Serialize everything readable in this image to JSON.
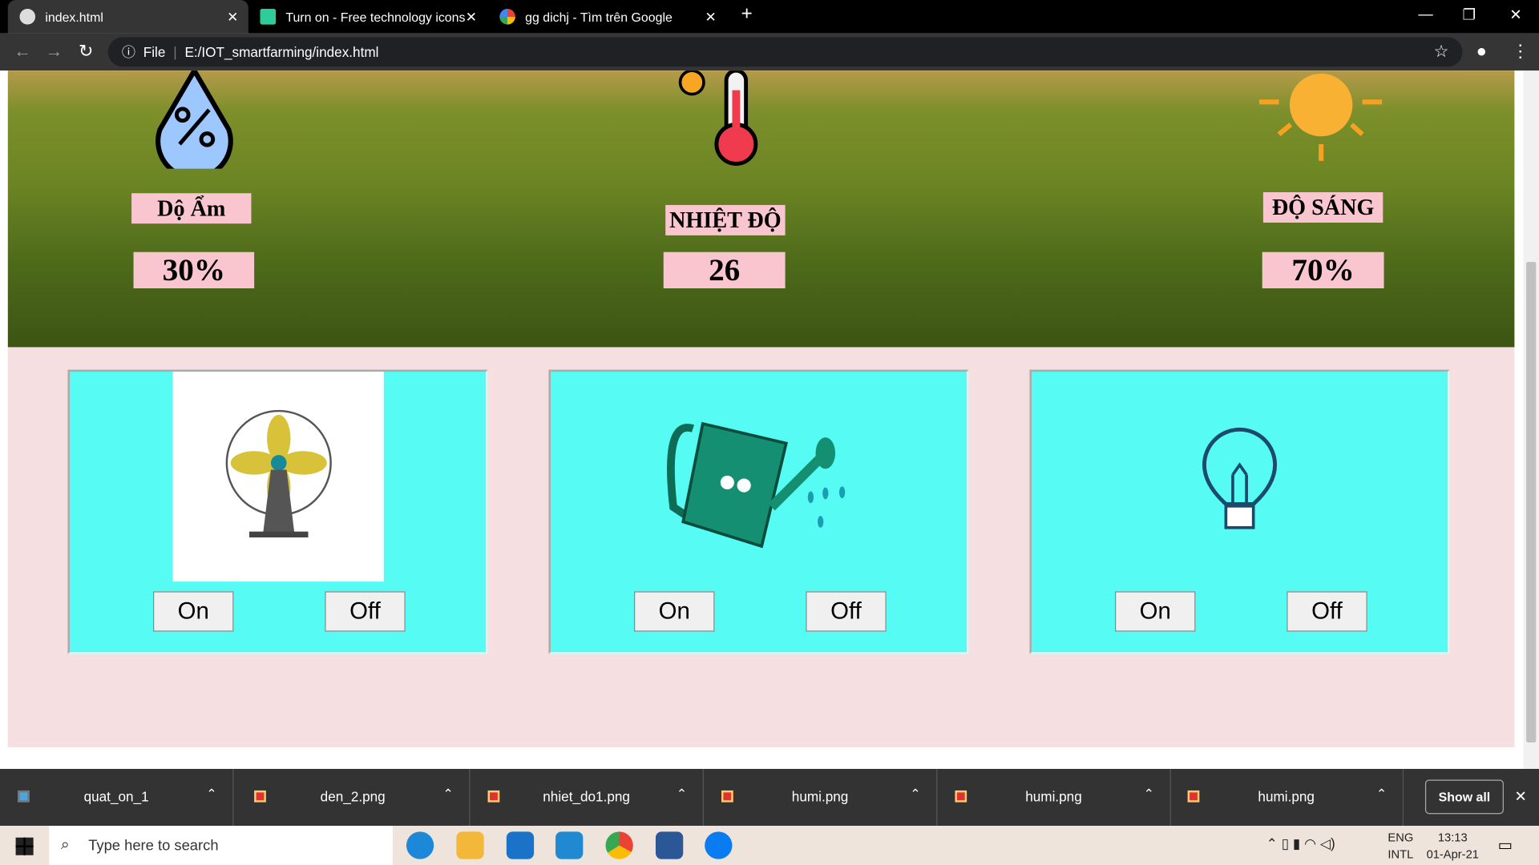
{
  "browser": {
    "tabs": [
      {
        "title": "index.html"
      },
      {
        "title": "Turn on - Free technology icons"
      },
      {
        "title": "gg dichj - Tìm trên Google"
      }
    ],
    "url_scheme": "File",
    "url": "E:/IOT_smartfarming/index.html"
  },
  "sensors": [
    {
      "label": "Dộ Ẩm",
      "value": "30%"
    },
    {
      "label": "NHIỆT ĐỘ",
      "value": "26"
    },
    {
      "label": "ĐỘ SÁNG",
      "value": "70%"
    }
  ],
  "devices": [
    {
      "name": "fan",
      "on": "On",
      "off": "Off"
    },
    {
      "name": "watering",
      "on": "On",
      "off": "Off"
    },
    {
      "name": "light",
      "on": "On",
      "off": "Off"
    }
  ],
  "downloads": {
    "items": [
      "quat_on_1",
      "den_2.png",
      "nhiet_do1.png",
      "humi.png",
      "humi.png",
      "humi.png"
    ],
    "show_all": "Show all"
  },
  "taskbar": {
    "search_placeholder": "Type here to search",
    "lang1": "ENG",
    "lang2": "INTL",
    "time": "13:13",
    "date": "01-Apr-21"
  }
}
